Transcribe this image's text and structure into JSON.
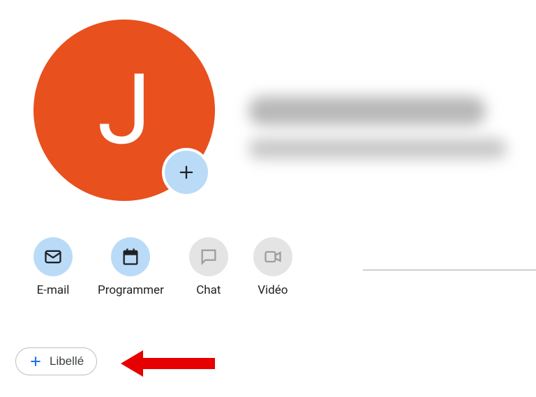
{
  "avatar": {
    "initial": "J"
  },
  "actions": {
    "email": "E-mail",
    "schedule": "Programmer",
    "chat": "Chat",
    "video": "Vidéo"
  },
  "label_button": "Libellé",
  "colors": {
    "avatar_bg": "#e8501e",
    "accent_blue": "#badbf7",
    "arrow_red": "#e60000",
    "plus_blue": "#1a73e8"
  }
}
